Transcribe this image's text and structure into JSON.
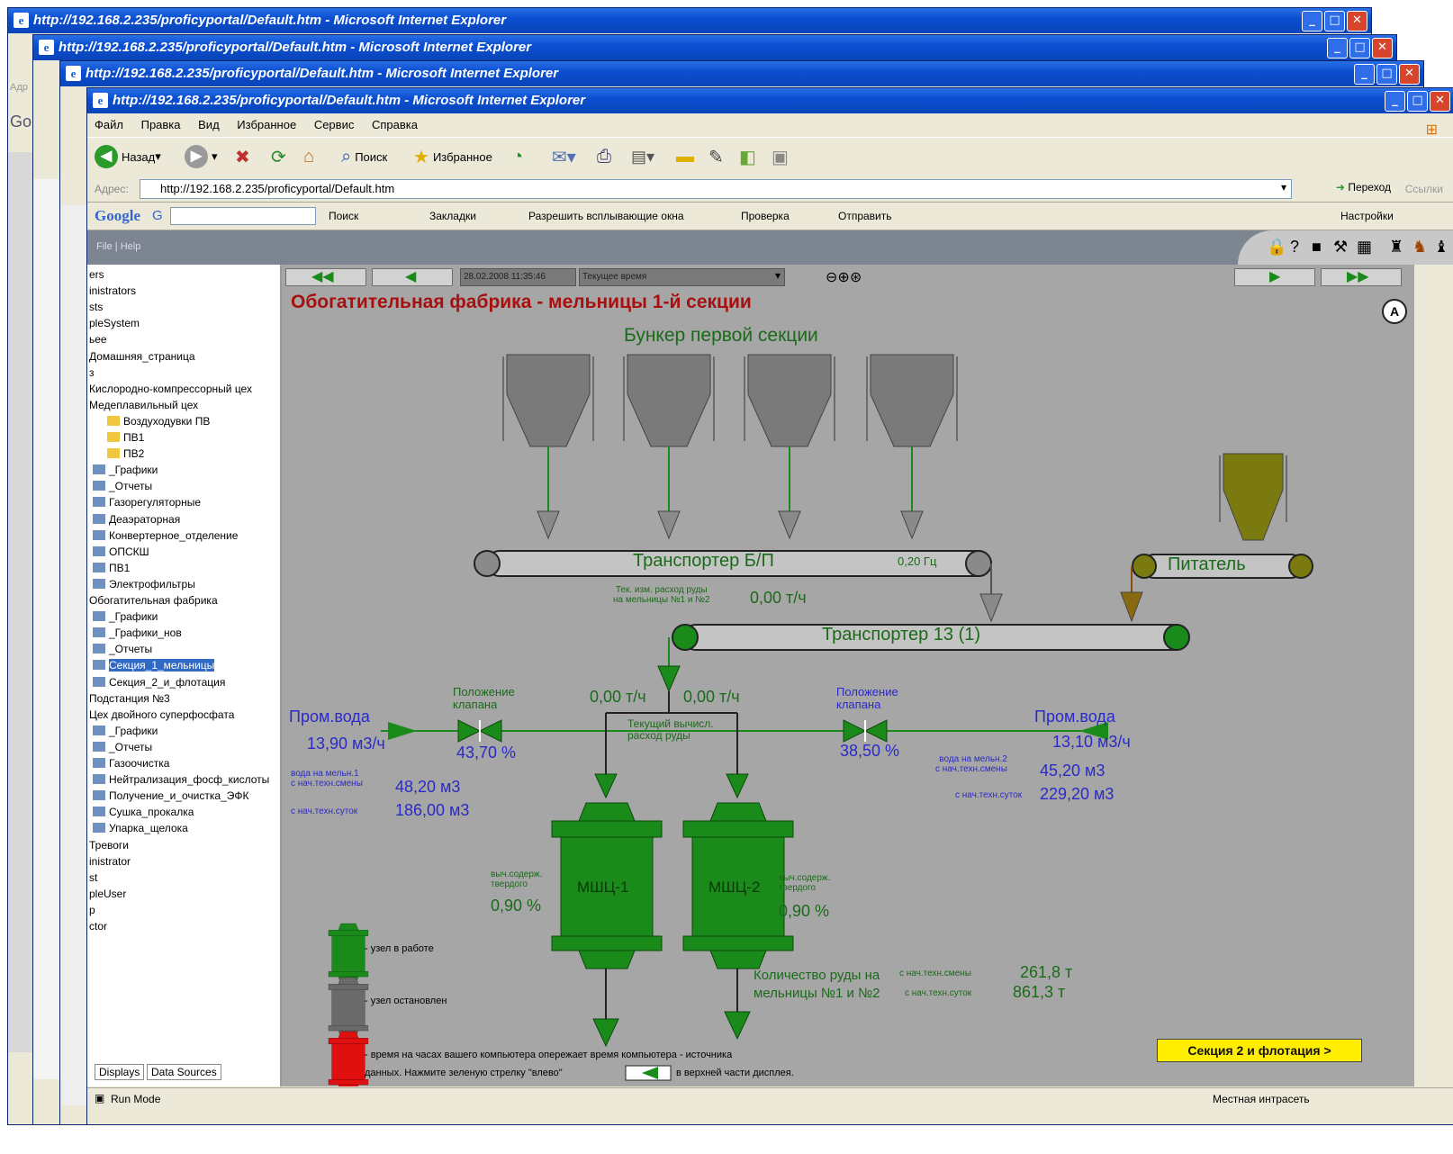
{
  "window": {
    "title": "http://192.168.2.235/proficyportal/Default.htm - Microsoft Internet Explorer",
    "menu": [
      "Файл",
      "Правка",
      "Вид",
      "Избранное",
      "Сервис",
      "Справка"
    ]
  },
  "toolbar": {
    "back": "Назад",
    "search": "Поиск",
    "favorites": "Избранное"
  },
  "address": {
    "label": "Адрес:",
    "url": "http://192.168.2.235/proficyportal/Default.htm",
    "go": "Переход",
    "links": "Ссылки"
  },
  "google": {
    "brand": "Google",
    "g": "G",
    "search": "Поиск",
    "bookmarks": "Закладки",
    "popups": "Разрешить всплывающие окна",
    "check": "Проверка",
    "send": "Отправить",
    "settings": "Настройки"
  },
  "app": {
    "menu": "File | Help"
  },
  "tree": {
    "items": [
      "ers",
      "inistrators",
      "sts",
      "pleSystem",
      "ьее",
      "Домашняя_страница",
      "з",
      "Кислородно-компрессорный цех",
      "Медеплавильный цех",
      "Воздуходувки ПВ",
      "ПВ1",
      "ПВ2",
      "_Графики",
      "_Отчеты",
      "Газорегуляторные",
      "Деаэраторная",
      "Конвертерное_отделение",
      "ОПСКШ",
      "ПВ1",
      "Электрофильтры",
      "Обогатительная фабрика",
      "_Графики",
      "_Графики_нов",
      "_Отчеты",
      "Секция_1_мельницы",
      "Секция_2_и_флотация",
      "Подстанция №3",
      "Цех двойного суперфосфата",
      "_Графики",
      "_Отчеты",
      "Газоочистка",
      "Нейтрализация_фосф_кислоты",
      "Получение_и_очистка_ЭФК",
      "Сушка_прокалка",
      "Упарка_щелока",
      "Тревоги",
      "inistrator",
      "st",
      "pleUser",
      "p",
      "ctor"
    ],
    "tabs": [
      "Displays",
      "Data Sources"
    ]
  },
  "status": {
    "mode": "Run Mode",
    "zone": "Местная интрасеть"
  },
  "scada": {
    "datetime": "28.02.2008 11:35:46",
    "time_mode": "Текущее время",
    "title": "Обогатительная фабрика - мельницы 1-й секции",
    "bunker_title": "Бункер первой секции",
    "conveyor_bp": "Транспортер Б/П",
    "conveyor_freq": "0,20 Гц",
    "feeder": "Питатель",
    "conveyor_13": "Транспортер 13 (1)",
    "ore_flow_label_1": "Тек. изм. расход руды",
    "ore_flow_label_2": "на мельницы №1 и №2",
    "ore_flow_value": "0,00 т/ч",
    "flow_left": "0,00 т/ч",
    "flow_right": "0,00 т/ч",
    "calc_label_1": "Текущий вычисл.",
    "calc_label_2": "расход руды",
    "valve_label_1": "Положение",
    "valve_label_2": "клапана",
    "left": {
      "water": "Пром.вода",
      "water_flow": "13,90 м3/ч",
      "valve_pos": "43,70 %",
      "mill_water_1": "вода на мельн.1",
      "since_shift": "с нач.техн.смены",
      "shift_value": "48,20 м3",
      "since_day": "с нач.техн.суток",
      "day_value": "186,00 м3"
    },
    "right": {
      "water": "Пром.вода",
      "water_flow": "13,10 м3/ч",
      "valve_pos": "38,50 %",
      "mill_water_1": "вода на мельн.2",
      "since_shift": "с нач.техн.смены",
      "shift_value": "45,20 м3",
      "since_day": "с нач.техн.суток",
      "day_value": "229,20 м3"
    },
    "mill1": "МШЦ-1",
    "mill2": "МШЦ-2",
    "solid_label_1": "выч.содерж.",
    "solid_label_2": "твердого",
    "solid_left": "0,90 %",
    "solid_right": "0,90 %",
    "ore_qty_1": "Количество руды на",
    "ore_qty_2": "мельницы №1 и №2",
    "qty_shift_label": "с нач.техн.смены",
    "qty_shift_value": "261,8 т",
    "qty_day_label": "с нач.техн.суток",
    "qty_day_value": "861,3 т",
    "legend_running": "- узел в работе",
    "legend_stopped": "- узел остановлен",
    "legend_clock_1": "- время на часах вашего компьютера опережает время компьютера - источника",
    "legend_clock_2": "данных. Нажмите зеленую стрелку \"влево\"",
    "legend_clock_3": "в верхней части дисплея.",
    "next_button": "Секция 2 и флотация >",
    "auto": "A"
  },
  "colors": {
    "running": "#1a8a1a",
    "stopped": "#6a6a6a",
    "alarm": "#e01010",
    "background": "#a6a6a6"
  }
}
